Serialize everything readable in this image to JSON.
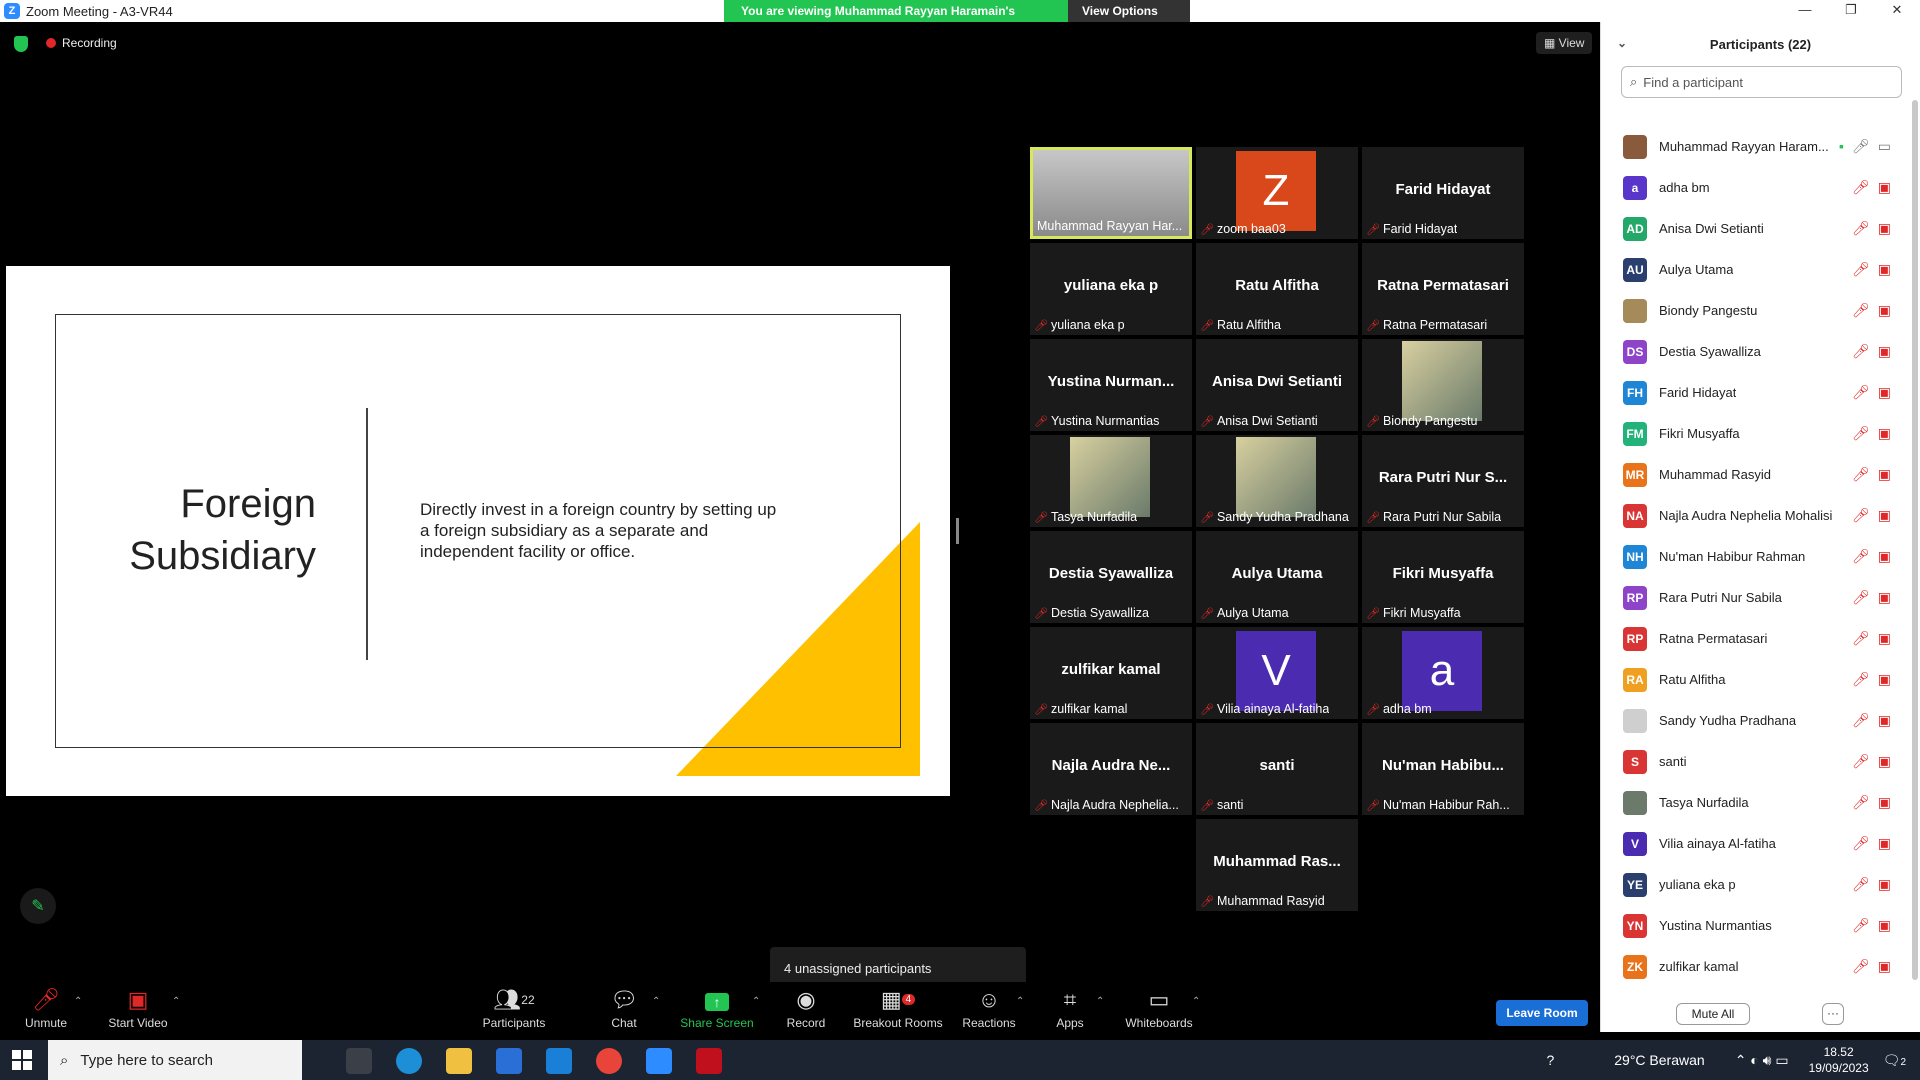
{
  "window": {
    "title": "Zoom Meeting - A3-VR44",
    "controls": [
      "—",
      "❐",
      "✕"
    ]
  },
  "share_banner": {
    "message": "You are viewing Muhammad Rayyan Haramain's screen",
    "view_options": "View Options"
  },
  "meeting": {
    "recording_label": "Recording",
    "view_label": "View"
  },
  "slide": {
    "title_line1": "Foreign",
    "title_line2": "Subsidiary",
    "body": "Directly invest in a foreign country by setting up a foreign subsidiary as a separate and independent facility or office.",
    "accent_color": "#FFC000"
  },
  "gallery": [
    {
      "name": "Muhammad Rayyan Har...",
      "kind": "video"
    },
    {
      "name": "zoom baa03",
      "kind": "letter",
      "letter": "Z",
      "color": "#d9481b"
    },
    {
      "name": "Farid Hidayat",
      "big": "Farid Hidayat",
      "kind": "text"
    },
    {
      "name": "yuliana eka p",
      "big": "yuliana eka p",
      "kind": "text"
    },
    {
      "name": "Ratu Alfitha",
      "big": "Ratu Alfitha",
      "kind": "text"
    },
    {
      "name": "Ratna Permatasari",
      "big": "Ratna Permatasari",
      "kind": "text"
    },
    {
      "name": "Yustina Nurmantias",
      "big": "Yustina Nurman...",
      "kind": "text"
    },
    {
      "name": "Anisa Dwi Setianti",
      "big": "Anisa Dwi Setianti",
      "kind": "text"
    },
    {
      "name": "Biondy Pangestu",
      "kind": "photo"
    },
    {
      "name": "Tasya Nurfadila",
      "kind": "photo"
    },
    {
      "name": "Sandy Yudha Pradhana",
      "kind": "photo"
    },
    {
      "name": "Rara Putri Nur Sabila",
      "big": "Rara Putri Nur S...",
      "kind": "text"
    },
    {
      "name": "Destia Syawalliza",
      "big": "Destia Syawalliza",
      "kind": "text"
    },
    {
      "name": "Aulya Utama",
      "big": "Aulya Utama",
      "kind": "text"
    },
    {
      "name": "Fikri Musyaffa",
      "big": "Fikri Musyaffa",
      "kind": "text"
    },
    {
      "name": "zulfikar kamal",
      "big": "zulfikar kamal",
      "kind": "text"
    },
    {
      "name": "Vilia ainaya Al-fatiha",
      "kind": "letter",
      "letter": "V",
      "color": "#4b2bb0"
    },
    {
      "name": "adha bm",
      "kind": "letter",
      "letter": "a",
      "color": "#4b2bb0"
    },
    {
      "name": "Najla Audra Nephelia...",
      "big": "Najla Audra Ne...",
      "kind": "text"
    },
    {
      "name": "santi",
      "big": "santi",
      "kind": "text"
    },
    {
      "name": "Nu'man Habibur Rah...",
      "big": "Nu'man  Habibu...",
      "kind": "text"
    },
    {
      "name": "Muhammad Rasyid",
      "big": "Muhammad Ras...",
      "kind": "text"
    }
  ],
  "unassigned": "4 unassigned participants",
  "toolbar": {
    "unmute": "Unmute",
    "start_video": "Start Video",
    "participants": "Participants",
    "participants_count": "22",
    "chat": "Chat",
    "share_screen": "Share Screen",
    "record": "Record",
    "breakout": "Breakout Rooms",
    "breakout_badge": "4",
    "reactions": "Reactions",
    "apps": "Apps",
    "whiteboards": "Whiteboards",
    "leave": "Leave Room"
  },
  "panel": {
    "title": "Participants (22)",
    "search_placeholder": "Find a participant",
    "mute_all": "Mute All",
    "more": "···",
    "participants": [
      {
        "name": "Muhammad Rayyan Haram...",
        "initials": "",
        "color": "#8a5a3c",
        "host": true
      },
      {
        "name": "adha bm",
        "initials": "a",
        "color": "#5a35c9"
      },
      {
        "name": "Anisa Dwi Setianti",
        "initials": "AD",
        "color": "#23a86a"
      },
      {
        "name": "Aulya Utama",
        "initials": "AU",
        "color": "#2a3f6e"
      },
      {
        "name": "Biondy Pangestu",
        "initials": "",
        "color": "#a58a5a"
      },
      {
        "name": "Destia Syawalliza",
        "initials": "DS",
        "color": "#8e44c9"
      },
      {
        "name": "Farid Hidayat",
        "initials": "FH",
        "color": "#1f86d6"
      },
      {
        "name": "Fikri Musyaffa",
        "initials": "FM",
        "color": "#23b37a"
      },
      {
        "name": "Muhammad Rasyid",
        "initials": "MR",
        "color": "#e8731a"
      },
      {
        "name": "Najla Audra Nephelia Mohalisi",
        "initials": "NA",
        "color": "#d93535"
      },
      {
        "name": "Nu'man Habibur Rahman",
        "initials": "NH",
        "color": "#1f86d6"
      },
      {
        "name": "Rara Putri Nur Sabila",
        "initials": "RP",
        "color": "#8e44c9"
      },
      {
        "name": "Ratna Permatasari",
        "initials": "RP",
        "color": "#d93535"
      },
      {
        "name": "Ratu Alfitha",
        "initials": "RA",
        "color": "#f0a020"
      },
      {
        "name": "Sandy Yudha Pradhana",
        "initials": "",
        "color": "#cfcfcf"
      },
      {
        "name": "santi",
        "initials": "S",
        "color": "#d93535"
      },
      {
        "name": "Tasya Nurfadila",
        "initials": "",
        "color": "#6b7a6b"
      },
      {
        "name": "Vilia ainaya Al-fatiha",
        "initials": "V",
        "color": "#4b2bb0"
      },
      {
        "name": "yuliana eka p",
        "initials": "YE",
        "color": "#2a3f6e"
      },
      {
        "name": "Yustina Nurmantias",
        "initials": "YN",
        "color": "#d93535"
      },
      {
        "name": "zulfikar kamal",
        "initials": "ZK",
        "color": "#e8731a"
      }
    ]
  },
  "taskbar": {
    "search_placeholder": "Type here to search",
    "weather": "29°C  Berawan",
    "time": "18.52",
    "date": "19/09/2023",
    "notif_count": "2"
  }
}
